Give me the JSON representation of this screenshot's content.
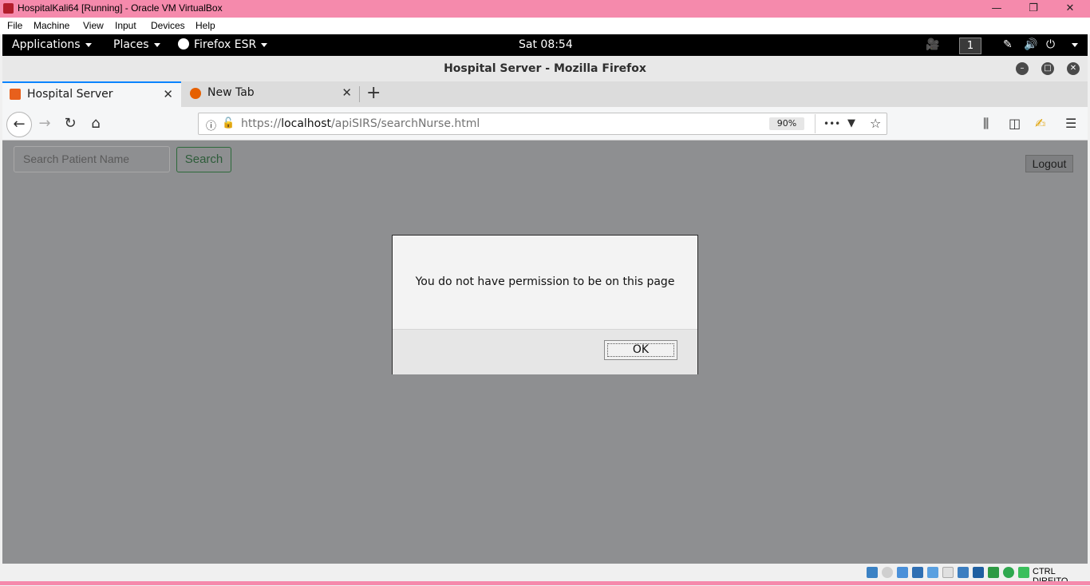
{
  "vbox": {
    "window_title": "HospitalKali64 [Running] - Oracle VM VirtualBox",
    "menu": [
      "File",
      "Machine",
      "View",
      "Input",
      "Devices",
      "Help"
    ],
    "controls": {
      "minimize": "—",
      "restore": "❐",
      "close": "✕"
    },
    "host_key": "CTRL DIREITO"
  },
  "gnome": {
    "applications": "Applications",
    "places": "Places",
    "firefox": "Firefox ESR",
    "clock": "Sat 08:54",
    "workspace": "1"
  },
  "firefox": {
    "window_title": "Hospital Server - Mozilla Firefox",
    "tabs": [
      {
        "label": "Hospital Server",
        "close": "✕"
      },
      {
        "label": "New Tab",
        "close": "✕"
      }
    ],
    "new_tab": "+",
    "url": {
      "scheme": "https://",
      "host": "localhost",
      "path": "/apiSIRS/searchNurse.html"
    },
    "zoom": "90%",
    "more": "•••"
  },
  "page": {
    "search_placeholder": "Search Patient Name",
    "search_button": "Search",
    "logout_button": "Logout"
  },
  "dialog": {
    "message": "You do not have permission to be on this page",
    "ok": "OK"
  }
}
